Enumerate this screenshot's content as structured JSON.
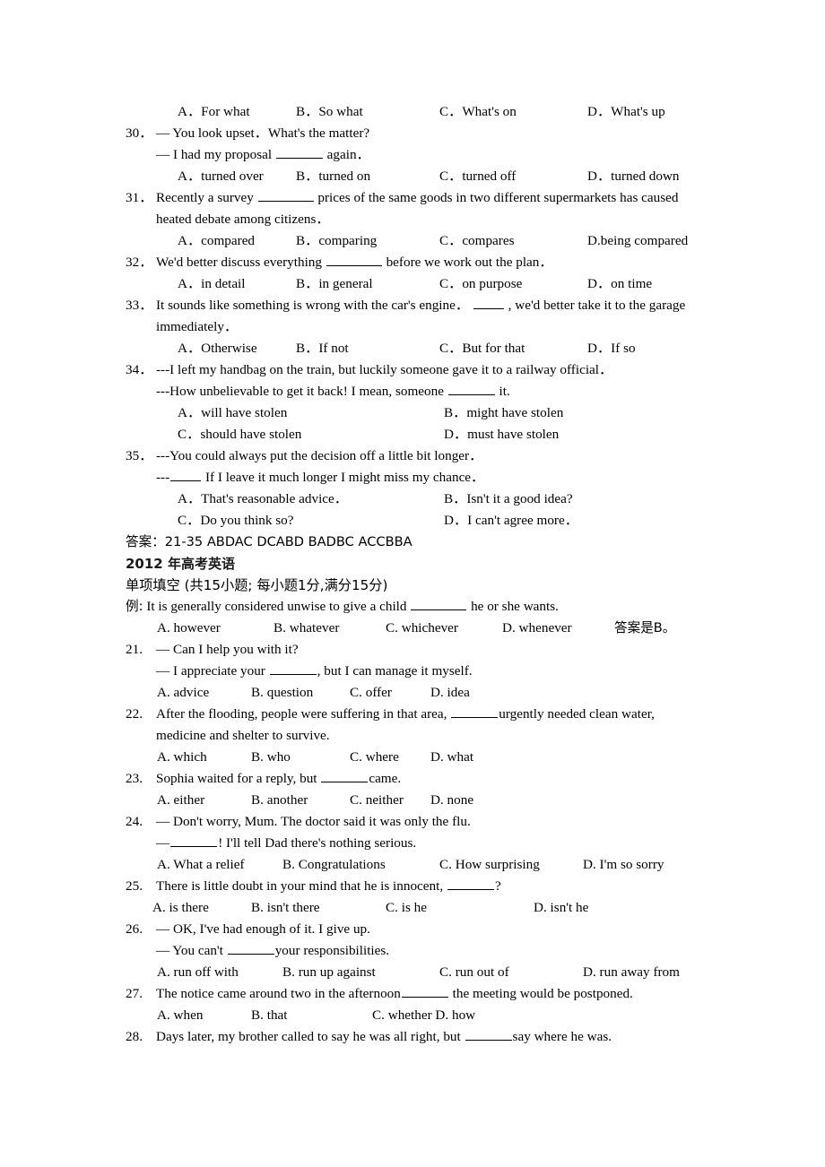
{
  "document": {
    "sections": [
      {
        "id": "section-2011-tail",
        "rows": [
          {
            "type": "options",
            "style": "wide",
            "options": [
              "A．For what",
              "B．So what",
              "C．What's on",
              "D．What's up"
            ]
          },
          {
            "type": "question-first",
            "number": "30．",
            "text": "— You look upset．What's the matter?"
          },
          {
            "type": "question-cont",
            "pre": "— I had my proposal ",
            "blank": "medium",
            "post": " again．"
          },
          {
            "type": "options",
            "style": "wide",
            "options": [
              "A．turned over",
              "B．turned on",
              "C．turned off",
              "D．turned down"
            ]
          },
          {
            "type": "question-first",
            "number": "31．",
            "pre": "Recently a survey ",
            "blank": "long",
            "post": " prices of the same goods in two different supermarkets has caused"
          },
          {
            "type": "question-cont",
            "text": "heated debate among citizens．"
          },
          {
            "type": "options",
            "style": "wide",
            "options": [
              "A．compared",
              "B．comparing",
              "C．compares",
              "D.being compared"
            ]
          },
          {
            "type": "question-first",
            "number": "32．",
            "pre": "We'd better discuss everything ",
            "blank": "long",
            "post": " before we work out the plan．"
          },
          {
            "type": "options",
            "style": "wide",
            "options": [
              "A．in detail",
              "B．in general",
              "C．on purpose",
              "D．on time"
            ]
          },
          {
            "type": "question-first",
            "number": "33．",
            "pre": "It sounds like something is wrong with the car's engine．  ",
            "blank": "short",
            "post": " , we'd better take it to the garage"
          },
          {
            "type": "question-cont",
            "text": "immediately．"
          },
          {
            "type": "options",
            "style": "wide",
            "options": [
              "A．Otherwise",
              "B．If not",
              "C．But for that",
              "D．If so"
            ]
          },
          {
            "type": "question-first",
            "number": "34．",
            "text": "---I left my handbag on the train, but luckily someone gave it to a railway official．"
          },
          {
            "type": "question-cont",
            "pre": "---How unbelievable to get it back! I mean, someone ",
            "blank": "medium",
            "post": " it."
          },
          {
            "type": "options",
            "style": "half",
            "options": [
              "A．will have stolen",
              "B．might have stolen"
            ]
          },
          {
            "type": "options",
            "style": "half",
            "options": [
              "C．should have stolen",
              "D．must have stolen"
            ]
          },
          {
            "type": "question-first",
            "number": "35．",
            "text": "---You could always put the decision off a little bit longer．"
          },
          {
            "type": "question-cont",
            "pre": "---",
            "blank": "short",
            "post": " If I leave it much longer I might miss my chance．"
          },
          {
            "type": "options",
            "style": "half",
            "options": [
              "A．That's reasonable advice．",
              "B．Isn't it a good idea?"
            ]
          },
          {
            "type": "options",
            "style": "half",
            "options": [
              "C．Do you think so?",
              "D．I can't agree more．"
            ]
          }
        ],
        "answer_key": "答案：21-35 ABDAC DCABD BADBC ACCBBA"
      },
      {
        "id": "section-2012",
        "heading": "2012 年高考英语",
        "instructions": "单项填空 (共15小题; 每小题1分,满分15分)",
        "example": {
          "label": "例:",
          "pre": " It is generally considered unwise to give a child ",
          "blank": "long",
          "post": " he or she wants.",
          "options": [
            "A. however",
            "B. whatever",
            "C. whichever",
            "D. whenever"
          ],
          "answer_note": "答案是B。"
        },
        "rows": [
          {
            "type": "question-first",
            "number": "21.",
            "text": "— Can I help you with it?"
          },
          {
            "type": "question-cont",
            "pre": "— I appreciate your ",
            "blank": "medium",
            "post": ", but I can manage it myself."
          },
          {
            "type": "options",
            "style": "narrow",
            "options": [
              "A. advice",
              "B. question",
              "C. offer",
              "D. idea"
            ]
          },
          {
            "type": "question-first",
            "number": "22.",
            "pre": "After the flooding, people were suffering in that area, ",
            "blank": "medium",
            "post": "urgently needed clean water,"
          },
          {
            "type": "question-cont",
            "text": "medicine and shelter to survive."
          },
          {
            "type": "options",
            "style": "narrow",
            "options": [
              "A. which",
              "B. who",
              "C. where",
              "D. what"
            ]
          },
          {
            "type": "question-first",
            "number": "23.",
            "pre": "Sophia waited for a reply, but ",
            "blank": "medium",
            "post": "came."
          },
          {
            "type": "options",
            "style": "narrow",
            "options": [
              "A. either",
              "B. another",
              "C. neither",
              "D. none"
            ]
          },
          {
            "type": "question-first",
            "number": "24.",
            "text": "— Don't worry, Mum. The doctor said it was only the flu."
          },
          {
            "type": "question-cont",
            "pre": "—",
            "blank": "medium",
            "post": "! I'll tell Dad there's nothing serious."
          },
          {
            "type": "options",
            "style": "medium",
            "options": [
              "A. What a relief",
              "B. Congratulations",
              "C. How surprising",
              "D. I'm so sorry"
            ]
          },
          {
            "type": "question-first",
            "number": "25.",
            "pre": "There is little doubt in your mind that he is innocent, ",
            "blank": "medium",
            "post": "?"
          },
          {
            "type": "options",
            "style": "wide2",
            "options": [
              "A. is there",
              "B. isn't there",
              "C. is he",
              "D. isn't he"
            ]
          },
          {
            "type": "question-first",
            "number": "26.",
            "text": "— OK, I've had enough of it. I give up."
          },
          {
            "type": "question-cont",
            "pre": "— You can't ",
            "blank": "medium",
            "post": "your responsibilities."
          },
          {
            "type": "options",
            "style": "medium",
            "options": [
              "A. run off with",
              "B. run up against",
              "C. run out of",
              "D. run away from"
            ]
          },
          {
            "type": "question-first",
            "number": "27.",
            "pre": "The notice came around two in the afternoon",
            "blank": "medium",
            "post": " the meeting would be postponed."
          },
          {
            "type": "options",
            "style": "narrow2",
            "options": [
              "A. when",
              "B. that",
              "C. whether D. how"
            ]
          },
          {
            "type": "question-first",
            "number": "28.",
            "pre": "Days later, my brother called to say he was all right, but ",
            "blank": "medium",
            "post": "say where he was."
          }
        ]
      }
    ]
  }
}
